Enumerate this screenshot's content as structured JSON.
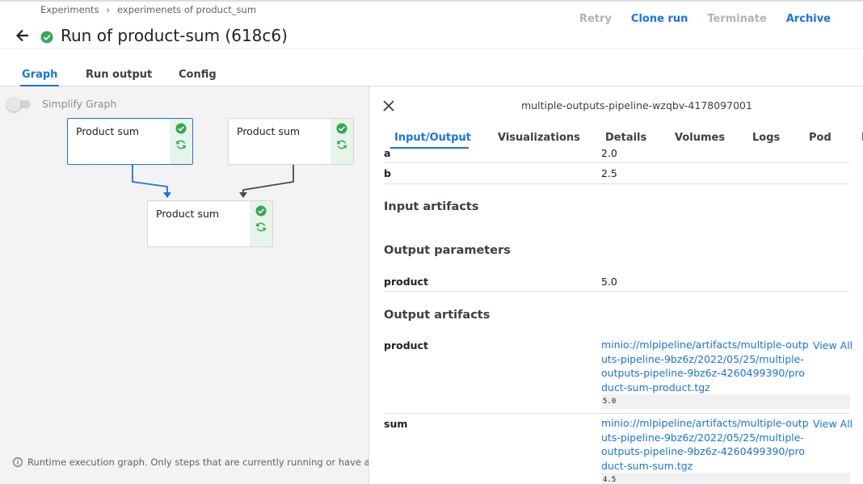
{
  "breadcrumb": {
    "item1": "Experiments",
    "separator": "›",
    "item2": "experimenets of product_sum"
  },
  "header": {
    "title": "Run of product-sum (618c6)"
  },
  "actions": {
    "retry": "Retry",
    "clone_run": "Clone run",
    "terminate": "Terminate",
    "archive": "Archive"
  },
  "tabs": {
    "graph": "Graph",
    "run_output": "Run output",
    "config": "Config"
  },
  "graph": {
    "simplify_label": "Simplify Graph",
    "nodes": [
      {
        "label": "Product sum",
        "selected": true
      },
      {
        "label": "Product sum",
        "selected": false
      },
      {
        "label": "Product sum",
        "selected": false
      }
    ],
    "footnote": "Runtime execution graph. Only steps that are currently running or have already completed are shown."
  },
  "panel": {
    "title": "multiple-outputs-pipeline-wzqbv-4178097001",
    "tabs": {
      "input_output": "Input/Output",
      "visualizations": "Visualizations",
      "details": "Details",
      "volumes": "Volumes",
      "logs": "Logs",
      "pod": "Pod",
      "more": "E"
    },
    "inputs": [
      {
        "key": "a",
        "value": "2.0"
      },
      {
        "key": "b",
        "value": "2.5"
      }
    ],
    "input_artifacts_heading": "Input artifacts",
    "output_parameters_heading": "Output parameters",
    "output_parameters": [
      {
        "key": "product",
        "value": "5.0"
      }
    ],
    "output_artifacts_heading": "Output artifacts",
    "output_artifacts": [
      {
        "key": "product",
        "uri": "minio://mlpipeline/artifacts/multiple-outputs-pipeline-9bz6z/2022/05/25/multiple-outputs-pipeline-9bz6z-4260499390/product-sum-product.tgz",
        "view_all": "View All",
        "preview": "5.0"
      },
      {
        "key": "sum",
        "uri": "minio://mlpipeline/artifacts/multiple-outputs-pipeline-9bz6z/2022/05/25/multiple-outputs-pipeline-9bz6z-4260499390/product-sum-sum.tgz",
        "view_all": "View All",
        "preview": "4.5"
      }
    ]
  },
  "colors": {
    "accent": "#1a73e8",
    "success": "#34a853",
    "success_bg": "#e6f4ea"
  }
}
